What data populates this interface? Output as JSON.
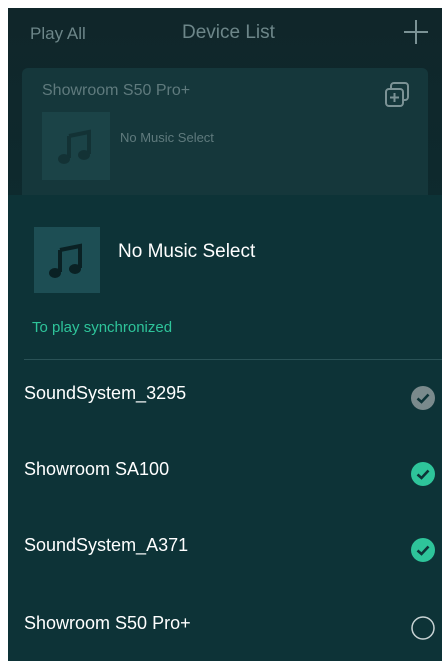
{
  "background": {
    "play_all": "Play All",
    "title": "Device List",
    "device_card": {
      "name": "Showroom S50 Pro+",
      "status": "No Music Select"
    }
  },
  "sheet": {
    "title": "No Music Select",
    "sync_label": "To play synchronized",
    "devices": [
      {
        "name": "SoundSystem_3295",
        "state": "checked-disabled"
      },
      {
        "name": "Showroom SA100",
        "state": "checked"
      },
      {
        "name": "SoundSystem_A371",
        "state": "checked"
      },
      {
        "name": "Showroom S50 Pro+",
        "state": "unchecked"
      }
    ]
  },
  "colors": {
    "accent": "#2ec49a",
    "sheet_bg": "#0d3337",
    "disabled_check": "#7a8a8c"
  },
  "icons": {
    "add": "plus-icon",
    "group": "group-add-icon",
    "music": "music-note-icon",
    "check": "check-circle-icon",
    "empty": "empty-circle-icon"
  }
}
